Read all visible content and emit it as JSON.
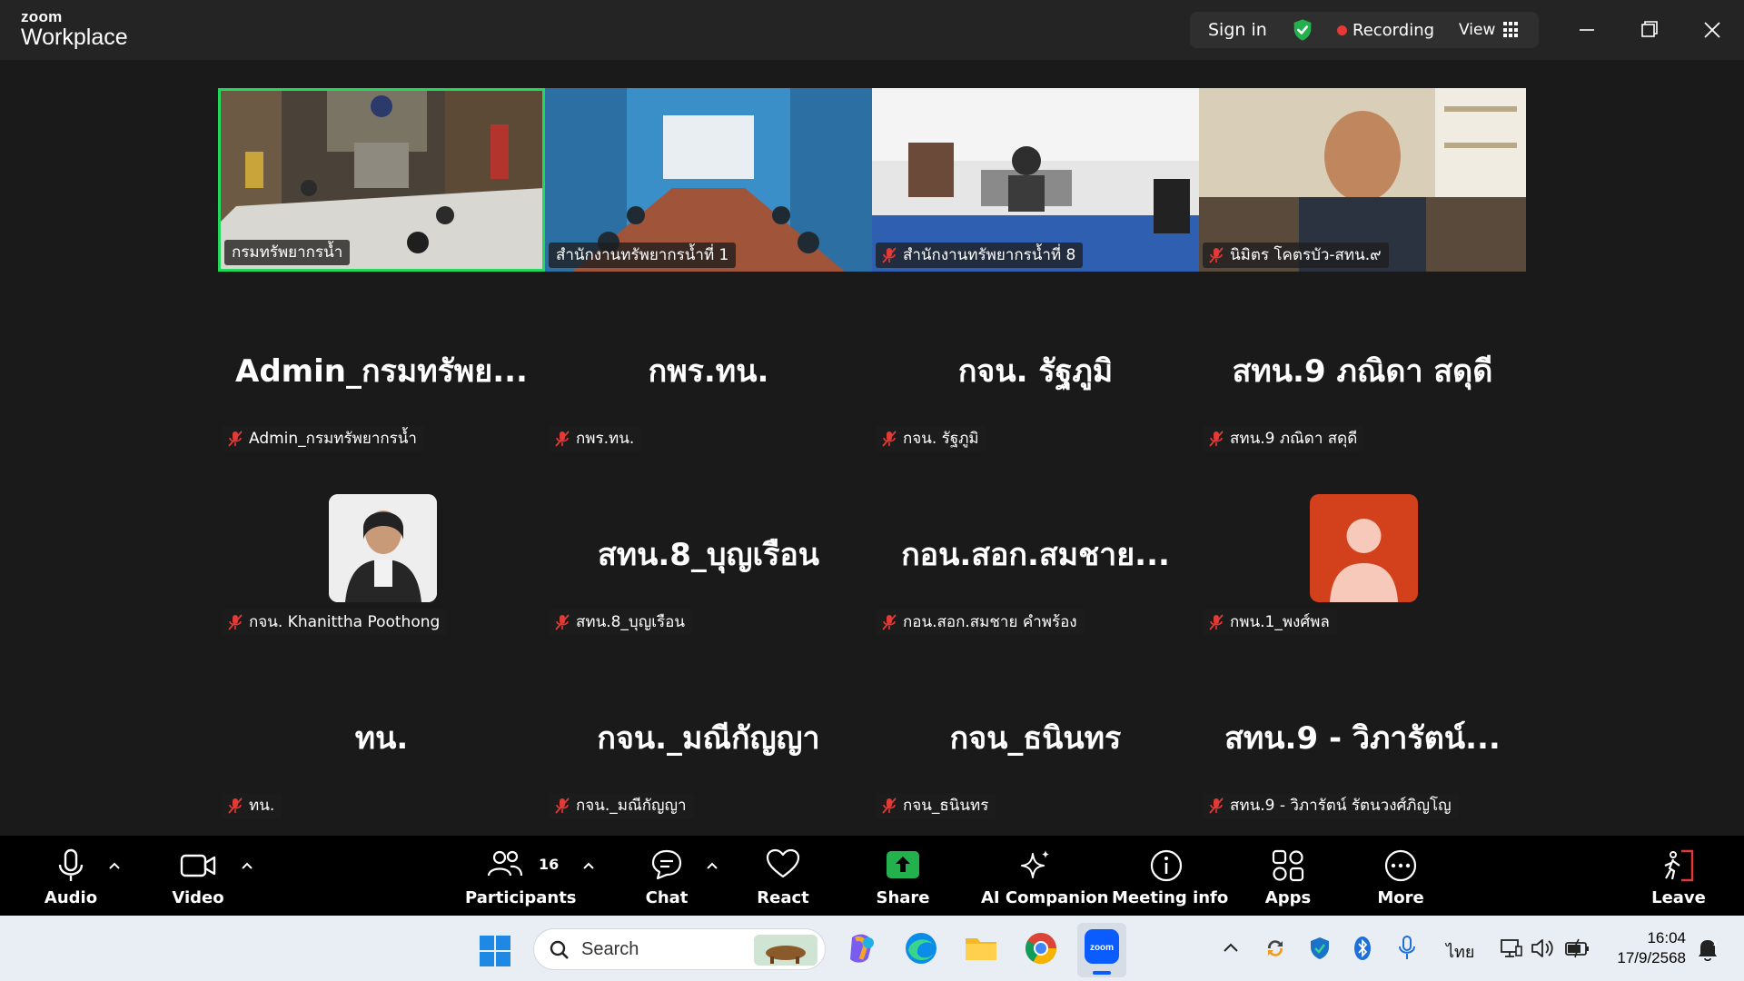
{
  "app": {
    "brand_small": "zoom",
    "brand_large": "Workplace"
  },
  "titlebar": {
    "sign_in": "Sign in",
    "recording": "Recording",
    "view": "View",
    "recording_color": "#e53935",
    "shield_color": "#23b14d"
  },
  "gallery": {
    "active_border_color": "#23d959",
    "tiles": [
      {
        "label": "กรมทรัพยากรน้ำ",
        "type": "video"
      },
      {
        "label": "สำนักงานทรัพยากรน้ำที่ 1",
        "type": "video"
      },
      {
        "label": "สำนักงานทรัพยากรน้ำที่ 8",
        "type": "video"
      },
      {
        "label": "นิมิตร โคตรบัว-สทน.๙",
        "type": "video"
      },
      {
        "display": "Admin_กรมทรัพย...",
        "label": "Admin_กรมทรัพยากรน้ำ",
        "type": "name"
      },
      {
        "display": "กพร.ทน.",
        "label": "กพร.ทน.",
        "type": "name"
      },
      {
        "display": "กจน. รัฐภูมิ",
        "label": "กจน. รัฐภูมิ",
        "type": "name"
      },
      {
        "display": "สทน.9 ภณิดา สดุดี",
        "label": "สทน.9 ภณิดา สดุดี",
        "type": "name"
      },
      {
        "label": "กจน. Khanittha Poothong",
        "type": "photo"
      },
      {
        "display": "สทน.8_บุญเรือน",
        "label": "สทน.8_บุญเรือน",
        "type": "name"
      },
      {
        "display": "กอน.สอก.สมชาย...",
        "label": "กอน.สอก.สมชาย คำพร้อง",
        "type": "name"
      },
      {
        "label": "กพน.1_พงศ์พล",
        "type": "default-avatar"
      },
      {
        "display": "ทน.",
        "label": "ทน.",
        "type": "name"
      },
      {
        "display": "กจน._มณีกัญญา",
        "label": "กจน._มณีกัญญา",
        "type": "name"
      },
      {
        "display": "กจน_ธนินทร",
        "label": "กจน_ธนินทร",
        "type": "name"
      },
      {
        "display": "สทน.9 - วิภารัตน์...",
        "label": "สทน.9 - วิภารัตน์ รัตนวงศ์ภิญโญ",
        "type": "name"
      }
    ]
  },
  "toolbar": {
    "audio": "Audio",
    "video": "Video",
    "participants": "Participants",
    "participants_count": "16",
    "chat": "Chat",
    "react": "React",
    "share": "Share",
    "ai_companion": "AI Companion",
    "meeting_info": "Meeting info",
    "apps": "Apps",
    "more": "More",
    "leave": "Leave",
    "share_color": "#23b14d",
    "leave_color": "#e53935"
  },
  "taskbar": {
    "search_placeholder": "Search",
    "language": "ไทย",
    "time": "16:04",
    "date": "17/9/2568"
  }
}
